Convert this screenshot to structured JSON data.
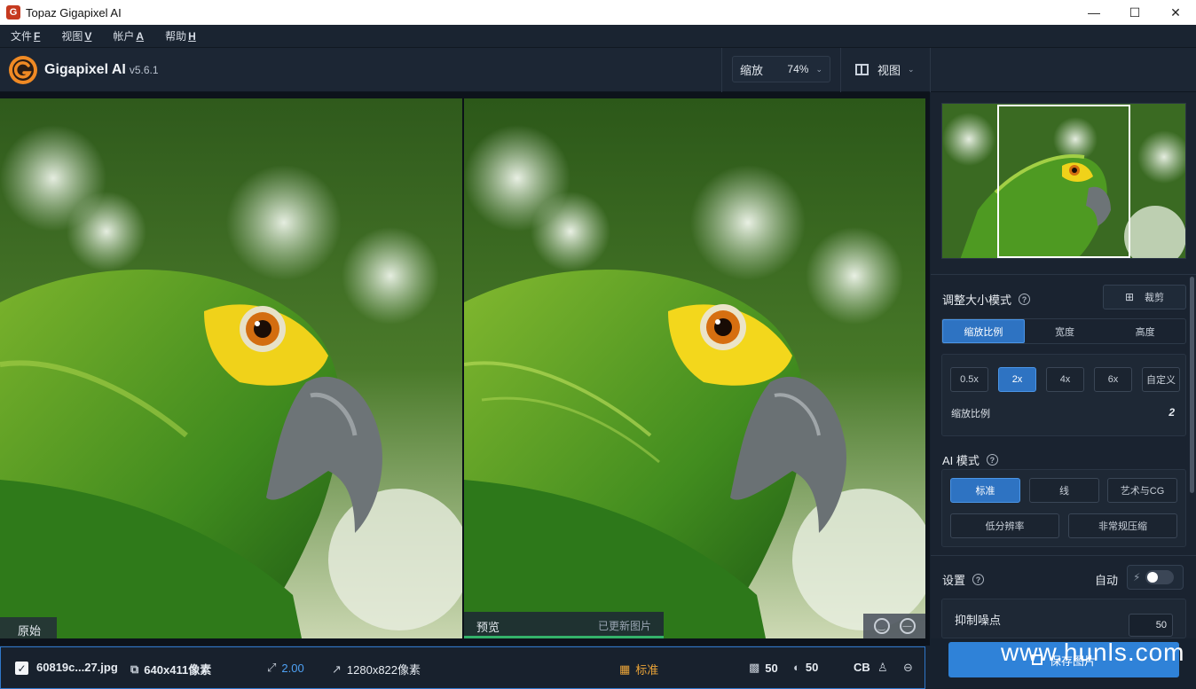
{
  "window": {
    "title": "Topaz Gigapixel AI",
    "icon_letter": "G",
    "minimize": "—",
    "maximize": "☐",
    "close": "✕"
  },
  "menu": [
    {
      "label": "文件",
      "key": "F"
    },
    {
      "label": "视图",
      "key": "V"
    },
    {
      "label": "帐户",
      "key": "A"
    },
    {
      "label": "帮助",
      "key": "H"
    }
  ],
  "header": {
    "product": "Gigapixel AI",
    "version": "v5.6.1",
    "zoom_label": "缩放",
    "zoom_value": "74%",
    "view_label": "视图"
  },
  "viewer": {
    "original_label": "原始",
    "preview_label": "预览",
    "preview_status": "已更新图片",
    "preview_progress": 1.0
  },
  "file_bar": {
    "filename": "60819c...27.jpg",
    "input_size": "640x411像素",
    "scale": "2.00",
    "output_size": "1280x822像素",
    "mode": "标准",
    "noise": "50",
    "blur": "50",
    "face_label": "CB"
  },
  "panel": {
    "resize_title": "调整大小模式",
    "crop_label": "裁剪",
    "resize_tabs": [
      {
        "label": "缩放比例",
        "active": true
      },
      {
        "label": "宽度",
        "active": false
      },
      {
        "label": "高度",
        "active": false
      }
    ],
    "scale_options": [
      {
        "label": "0.5x",
        "active": false
      },
      {
        "label": "2x",
        "active": true
      },
      {
        "label": "4x",
        "active": false
      },
      {
        "label": "6x",
        "active": false
      },
      {
        "label": "自定义",
        "active": false
      }
    ],
    "scale_label": "缩放比例",
    "scale_value": "2",
    "ai_title": "AI 模式",
    "ai_modes": [
      {
        "label": "标准",
        "active": true
      },
      {
        "label": "线",
        "active": false
      },
      {
        "label": "艺术与CG",
        "active": false
      },
      {
        "label": "低分辨率",
        "active": false
      },
      {
        "label": "非常规压缩",
        "active": false
      }
    ],
    "settings_title": "设置",
    "auto_label": "自动",
    "auto_on": false,
    "noise_label": "抑制噪点",
    "noise_value": "50"
  },
  "save_button": {
    "label": "保存图片"
  },
  "watermark": "www.hunls.com",
  "colors": {
    "accent": "#2e73c2",
    "progress": "#34b26a",
    "mode": "#e9a338",
    "logo": "#f08a24"
  }
}
